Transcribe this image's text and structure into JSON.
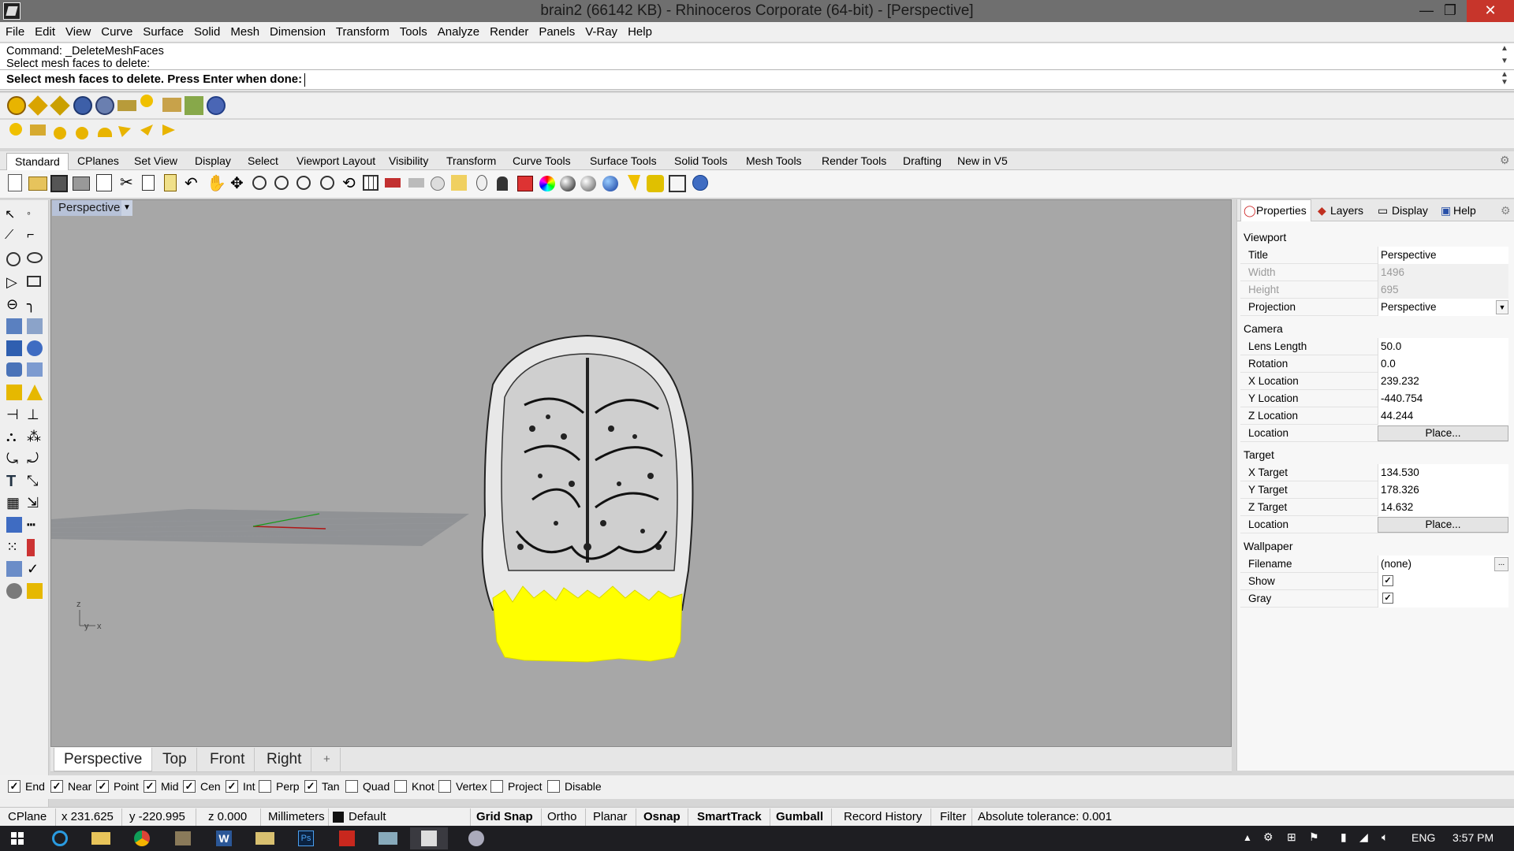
{
  "window": {
    "title": "brain2 (66142 KB) - Rhinoceros Corporate (64-bit) - [Perspective]",
    "minimize": "—",
    "maximize": "❐",
    "close": "✕"
  },
  "menu": [
    "File",
    "Edit",
    "View",
    "Curve",
    "Surface",
    "Solid",
    "Mesh",
    "Dimension",
    "Transform",
    "Tools",
    "Analyze",
    "Render",
    "Panels",
    "V-Ray",
    "Help"
  ],
  "command": {
    "history_1": "Command: _DeleteMeshFaces",
    "history_2": "Select mesh faces to delete:",
    "prompt": "Select mesh faces to delete. Press Enter when done:"
  },
  "toolbar_tabs": [
    "Standard",
    "CPlanes",
    "Set View",
    "Display",
    "Select",
    "Viewport Layout",
    "Visibility",
    "Transform",
    "Curve Tools",
    "Surface Tools",
    "Solid Tools",
    "Mesh Tools",
    "Render Tools",
    "Drafting",
    "New in V5"
  ],
  "viewport": {
    "label": "Perspective",
    "axis_z": "z",
    "axis_y": "y",
    "axis_x": "x"
  },
  "viewport_tabs": [
    "Perspective",
    "Top",
    "Front",
    "Right"
  ],
  "viewport_tab_add": "+",
  "osnaps": [
    {
      "label": "End",
      "checked": true
    },
    {
      "label": "Near",
      "checked": true
    },
    {
      "label": "Point",
      "checked": true
    },
    {
      "label": "Mid",
      "checked": true
    },
    {
      "label": "Cen",
      "checked": true
    },
    {
      "label": "Int",
      "checked": true
    },
    {
      "label": "Perp",
      "checked": false
    },
    {
      "label": "Tan",
      "checked": true
    },
    {
      "label": "Quad",
      "checked": false
    },
    {
      "label": "Knot",
      "checked": false
    },
    {
      "label": "Vertex",
      "checked": false
    },
    {
      "label": "Project",
      "checked": false
    },
    {
      "label": "Disable",
      "checked": false
    }
  ],
  "statusbar": {
    "cplane": "CPlane",
    "x": "x 231.625",
    "y": "y -220.995",
    "z": "z 0.000",
    "units": "Millimeters",
    "layer": "Default",
    "grid_snap": "Grid Snap",
    "ortho": "Ortho",
    "planar": "Planar",
    "osnap": "Osnap",
    "smarttrack": "SmartTrack",
    "gumball": "Gumball",
    "record_history": "Record History",
    "filter": "Filter",
    "tolerance": "Absolute tolerance: 0.001"
  },
  "panel": {
    "tabs": [
      "Properties",
      "Layers",
      "Display",
      "Help"
    ],
    "viewport_section": "Viewport",
    "title_label": "Title",
    "title_value": "Perspective",
    "width_label": "Width",
    "width_value": "1496",
    "height_label": "Height",
    "height_value": "695",
    "projection_label": "Projection",
    "projection_value": "Perspective",
    "camera_section": "Camera",
    "lens_label": "Lens Length",
    "lens_value": "50.0",
    "rotation_label": "Rotation",
    "rotation_value": "0.0",
    "xloc_label": "X Location",
    "xloc_value": "239.232",
    "yloc_label": "Y Location",
    "yloc_value": "-440.754",
    "zloc_label": "Z Location",
    "zloc_value": "44.244",
    "cam_location_label": "Location",
    "place_label": "Place...",
    "target_section": "Target",
    "xt_label": "X Target",
    "xt_value": "134.530",
    "yt_label": "Y Target",
    "yt_value": "178.326",
    "zt_label": "Z Target",
    "zt_value": "14.632",
    "tgt_location_label": "Location",
    "wallpaper_section": "Wallpaper",
    "filename_label": "Filename",
    "filename_value": "(none)",
    "browse": "...",
    "show_label": "Show",
    "show_checked": true,
    "gray_label": "Gray",
    "gray_checked": true
  },
  "taskbar": {
    "lang": "ENG",
    "time": "3:57 PM"
  },
  "colors": {
    "viewport_bg": "#a7a7a7",
    "selection": "#ffff00",
    "close_btn": "#c7352b"
  }
}
